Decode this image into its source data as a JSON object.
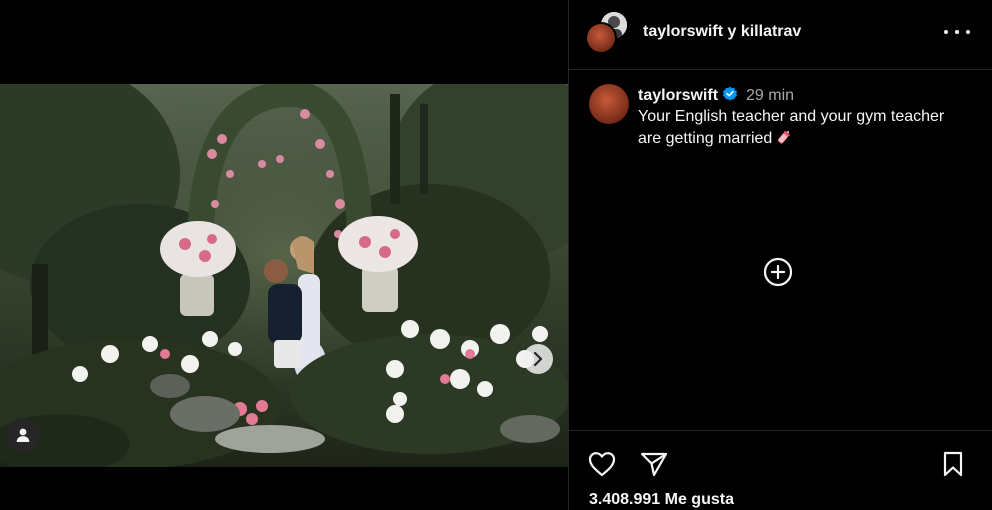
{
  "post": {
    "authors": {
      "primary": "taylorswift",
      "joiner": "y",
      "secondary": "killatrav"
    },
    "caption": {
      "username": "taylorswift",
      "verified": true,
      "time_ago": "29 min",
      "text": "Your English teacher and your gym teacher are getting married",
      "emoji": "baby-bottle-emoji"
    },
    "likes_text": "3.408.991 Me gusta"
  },
  "icons": {
    "more": "more-options-icon",
    "next": "chevron-right-icon",
    "tags": "user-tag-icon",
    "load_more": "plus-circle-icon",
    "like": "heart-icon",
    "share": "share-paper-plane-icon",
    "save": "bookmark-icon",
    "verified": "verified-badge-icon"
  },
  "colors": {
    "background": "#000000",
    "text": "#f5f5f5",
    "secondary_text": "#a8a8a8",
    "divider": "#262626",
    "verified_blue": "#0095f6"
  }
}
